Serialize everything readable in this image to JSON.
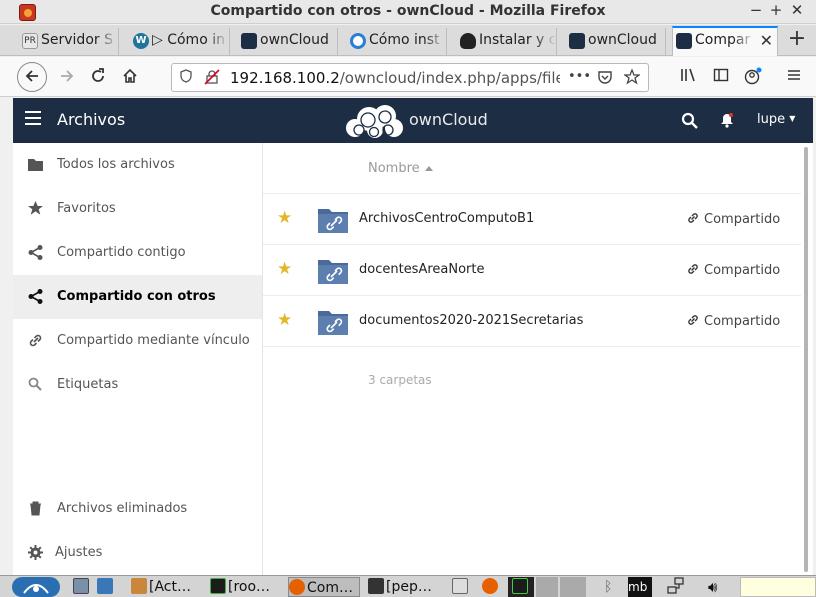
{
  "window": {
    "title": "Compartido con otros - ownCloud - Mozilla Firefox",
    "controls": [
      "−",
      "+",
      "✕"
    ]
  },
  "tabs": [
    {
      "label": "Servidor S",
      "icon": "pr-icon",
      "color": "#e8e8e8"
    },
    {
      "label": "▷ Cómo in",
      "icon": "wordpress-icon",
      "color": "#21759b"
    },
    {
      "label": "ownCloud",
      "icon": "owncloud-icon",
      "color": "#1d2d44"
    },
    {
      "label": "Cómo inst",
      "icon": "sync-icon",
      "color": "#2a7fd4"
    },
    {
      "label": "Instalar y c",
      "icon": "tux-icon",
      "color": "#222222"
    },
    {
      "label": "ownCloud",
      "icon": "owncloud-icon",
      "color": "#1d2d44"
    },
    {
      "label": "Compar",
      "icon": "owncloud-icon",
      "color": "#1d2d44",
      "active": true
    }
  ],
  "urlbar": {
    "url_host": "192.168.100.2",
    "url_path": "/owncloud/index.php/apps/files/",
    "more": "•••"
  },
  "header": {
    "app_title": "Archivos",
    "brand": "ownCloud",
    "user": "lupe"
  },
  "sidebar": {
    "items": [
      {
        "label": "Todos los archivos",
        "icon": "folder-icon"
      },
      {
        "label": "Favoritos",
        "icon": "star-icon"
      },
      {
        "label": "Compartido contigo",
        "icon": "share-icon"
      },
      {
        "label": "Compartido con otros",
        "icon": "share-icon",
        "active": true
      },
      {
        "label": "Compartido mediante vínculo",
        "icon": "link-icon"
      },
      {
        "label": "Etiquetas",
        "icon": "tag-search-icon"
      }
    ],
    "bottom": [
      {
        "label": "Archivos eliminados",
        "icon": "trash-icon"
      },
      {
        "label": "Ajustes",
        "icon": "gear-icon"
      }
    ]
  },
  "files": {
    "column_name": "Nombre",
    "rows": [
      {
        "name": "ArchivosCentroComputoB1",
        "share": "Compartido"
      },
      {
        "name": "docentesAreaNorte",
        "share": "Compartido"
      },
      {
        "name": "documentos2020-2021Secretarias",
        "share": "Compartido"
      }
    ],
    "summary": "3 carpetas"
  },
  "taskbar": {
    "items": [
      {
        "label": "[Act…",
        "icon": "package-icon"
      },
      {
        "label": "[roo…",
        "icon": "terminal-icon"
      },
      {
        "label": "Com…",
        "icon": "firefox-icon"
      },
      {
        "label": "[pep…",
        "icon": "folder-icon"
      }
    ],
    "tray_text": "mb"
  }
}
